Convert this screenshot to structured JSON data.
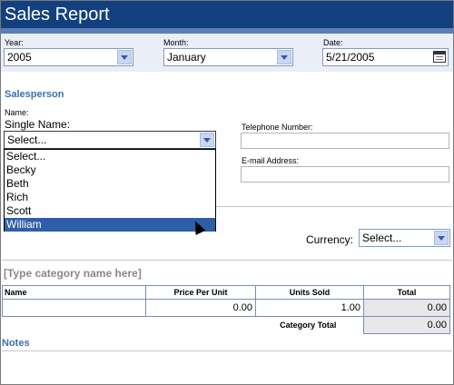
{
  "window": {
    "title": "Sales Report"
  },
  "header": {
    "year": {
      "label": "Year:",
      "value": "2005"
    },
    "month": {
      "label": "Month:",
      "value": "January"
    },
    "date": {
      "label": "Date:",
      "value": "5/21/2005"
    }
  },
  "salesperson": {
    "heading": "Salesperson",
    "name_label": "Name:",
    "single_name_label": "Single Name:",
    "single_name_value": "Select...",
    "options": [
      "Select...",
      "Becky",
      "Beth",
      "Rich",
      "Scott",
      "William"
    ],
    "selected_index": 5,
    "telephone_label": "Telephone Number:",
    "email_label": "E-mail Address:"
  },
  "currency": {
    "label": "Currency:",
    "value": "Select..."
  },
  "category": {
    "name_placeholder": "[Type category name here]",
    "columns": [
      "Name",
      "Price Per Unit",
      "Units Sold",
      "Total"
    ],
    "row": {
      "name": "",
      "price": "0.00",
      "units": "1.00",
      "total": "0.00"
    },
    "category_total_label": "Category Total",
    "category_total_value": "0.00"
  },
  "notes": {
    "heading": "Notes"
  },
  "icons": {
    "calendar": "calendar-icon",
    "dropdown": "chevron-down-icon",
    "cursor": "mouse-pointer-icon"
  }
}
